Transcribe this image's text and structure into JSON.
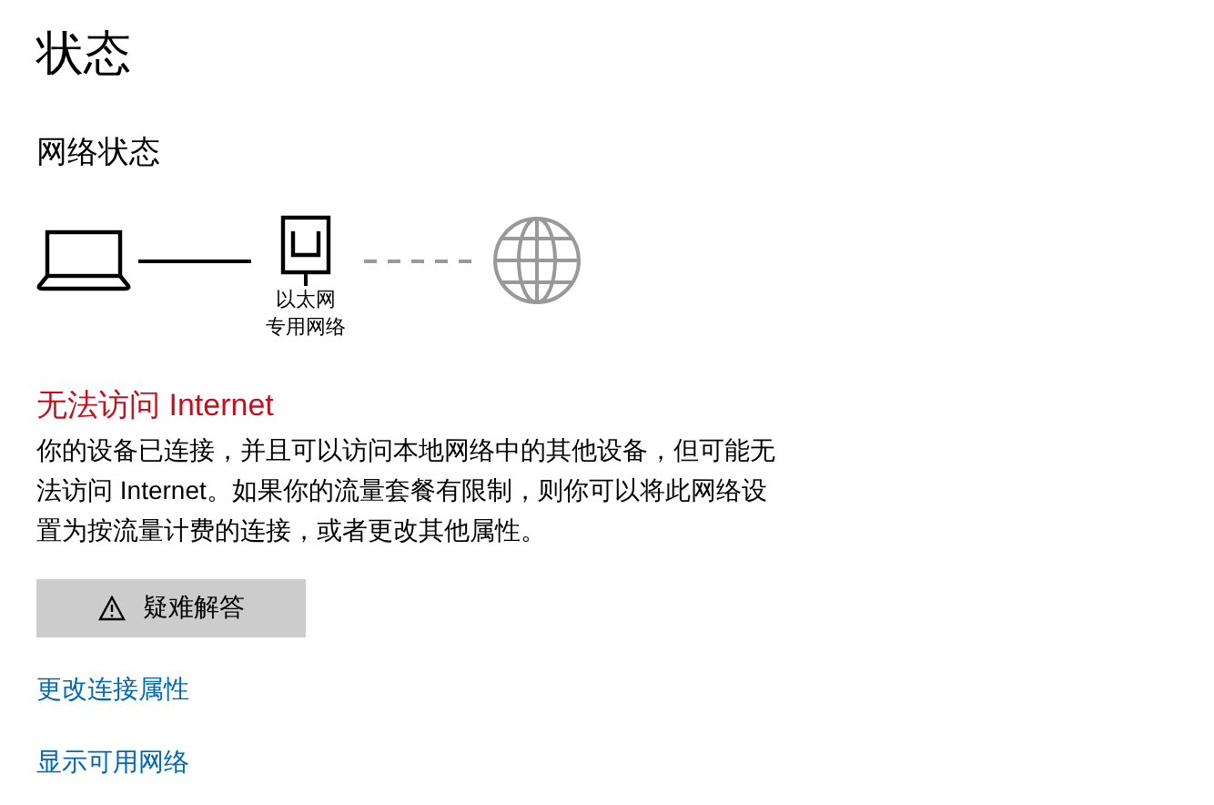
{
  "title": "状态",
  "section": "网络状态",
  "diagram": {
    "local_connected": true,
    "internet_connected": false,
    "adapter_name": "以太网",
    "network_profile": "专用网络"
  },
  "status": {
    "heading": "无法访问 Internet",
    "error": true,
    "description": "你的设备已连接，并且可以访问本地网络中的其他设备，但可能无法访问 Internet。如果你的流量套餐有限制，则你可以将此网络设置为按流量计费的连接，或者更改其他属性。"
  },
  "troubleshoot_button": "疑难解答",
  "links": [
    "更改连接属性",
    "显示可用网络"
  ]
}
